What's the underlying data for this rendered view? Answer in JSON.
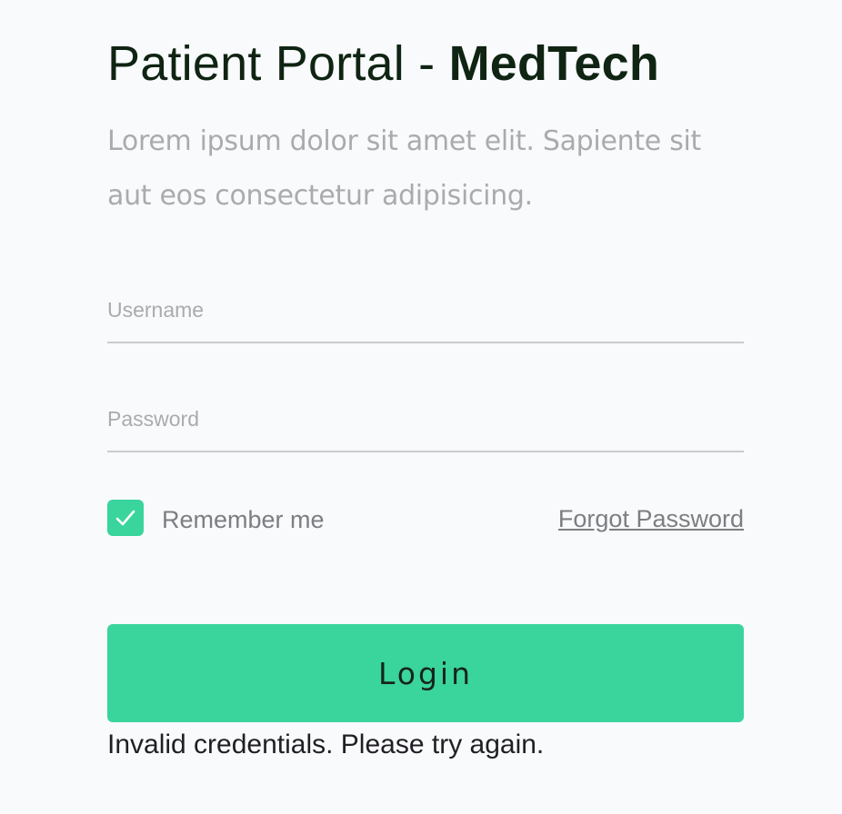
{
  "header": {
    "title_prefix": "Patient Portal - ",
    "title_brand": "MedTech",
    "subtitle": "Lorem ipsum dolor sit amet elit. Sapiente sit aut eos consectetur adipisicing."
  },
  "form": {
    "username": {
      "placeholder": "Username",
      "value": ""
    },
    "password": {
      "placeholder": "Password",
      "value": ""
    },
    "remember_me": {
      "label": "Remember me",
      "checked": true
    },
    "forgot_password_label": "Forgot Password",
    "login_label": "Login",
    "error_message": "Invalid credentials. Please try again."
  },
  "colors": {
    "accent": "#3ad49d",
    "title": "#0f2412",
    "muted_text": "#a9abae",
    "label_text": "#7c7e82",
    "background": "#f8fafc"
  },
  "icons": {
    "checkbox_check": "check-icon"
  }
}
